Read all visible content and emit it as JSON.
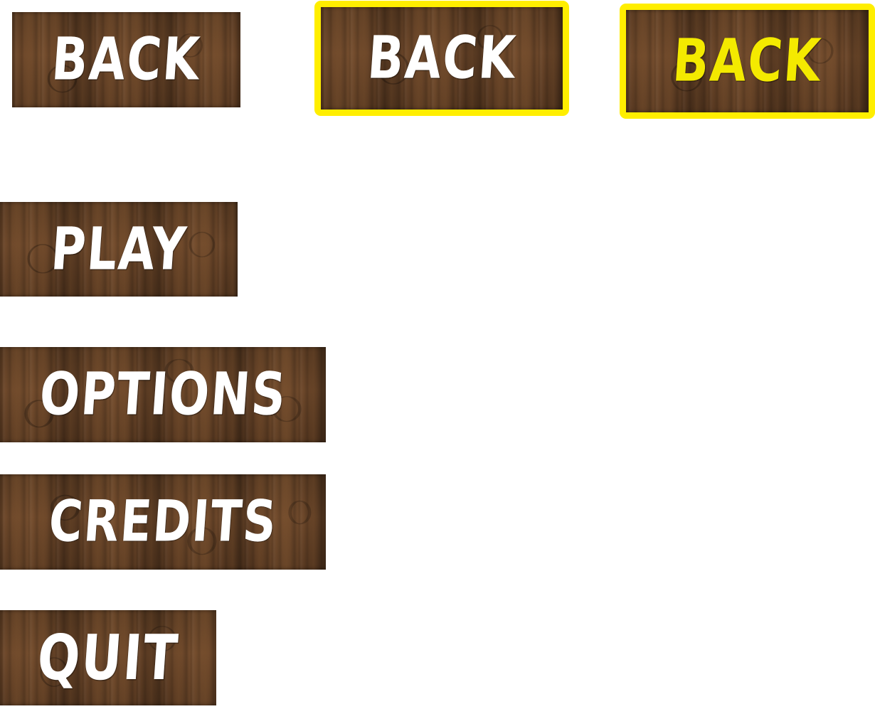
{
  "colors": {
    "wood_dark": "#4d331f",
    "wood_light": "#6b4629",
    "label_default": "#ffffff",
    "highlight": "#ffee00"
  },
  "back_buttons": {
    "normal_label": "BACK",
    "hover_label": "BACK",
    "pressed_label": "BACK"
  },
  "menu": {
    "play_label": "PLAY",
    "options_label": "OPTIONS",
    "credits_label": "CREDITS",
    "quit_label": "QUIT"
  }
}
